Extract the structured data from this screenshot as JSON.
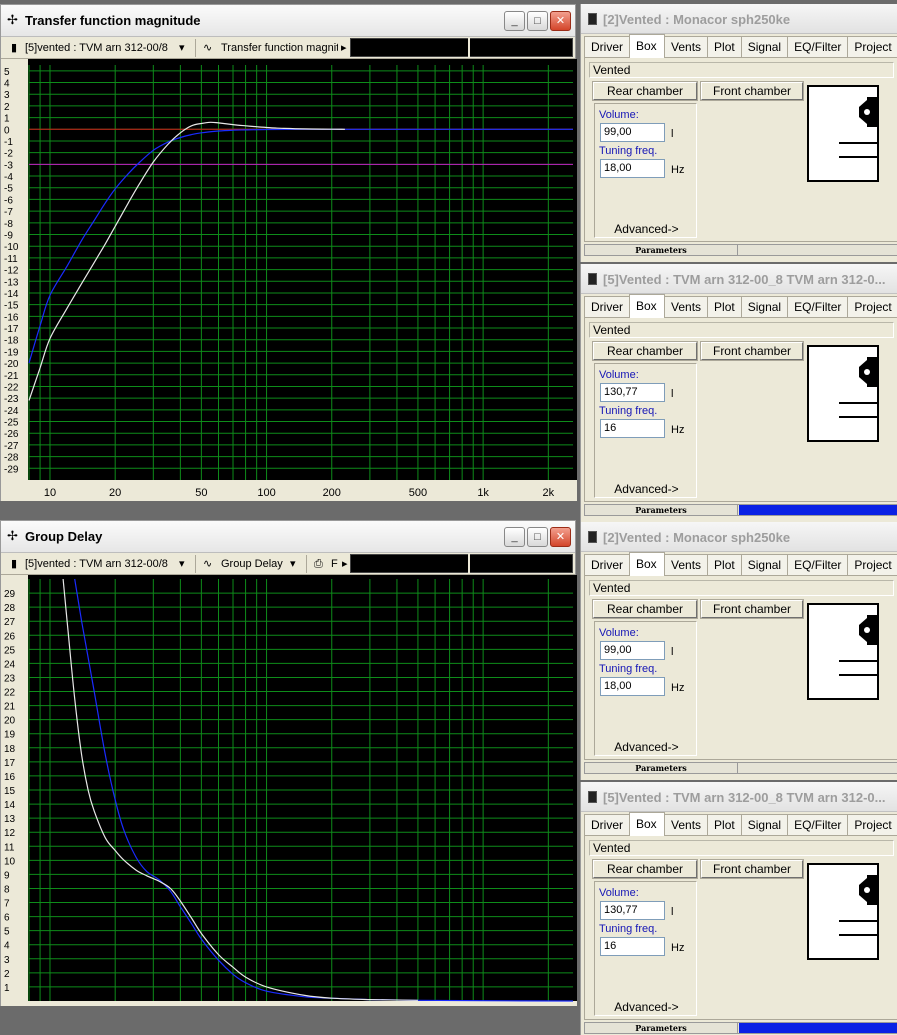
{
  "windows": {
    "magnitude": {
      "title": "Transfer function magnitude",
      "driver_select": "[5]vented : TVM arn 312-00/8",
      "view_select": "Transfer function magnitu",
      "y_ticks": [
        "5",
        "4",
        "3",
        "2",
        "1",
        "0",
        "-1",
        "-2",
        "-3",
        "-4",
        "-5",
        "-6",
        "-7",
        "-8",
        "-9",
        "-10",
        "-11",
        "-12",
        "-13",
        "-14",
        "-15",
        "-16",
        "-17",
        "-18",
        "-19",
        "-20",
        "-21",
        "-22",
        "-23",
        "-24",
        "-25",
        "-26",
        "-27",
        "-28",
        "-29"
      ],
      "x_ticks": [
        "10",
        "20",
        "50",
        "100",
        "200",
        "500",
        "1k",
        "2k"
      ]
    },
    "delay": {
      "title": "Group Delay",
      "driver_select": "[5]vented : TVM arn 312-00/8",
      "view_select": "Group Delay",
      "print_label": "F",
      "y_ticks": [
        "29",
        "28",
        "27",
        "26",
        "25",
        "24",
        "23",
        "22",
        "21",
        "20",
        "19",
        "18",
        "17",
        "16",
        "15",
        "14",
        "13",
        "12",
        "11",
        "10",
        "9",
        "8",
        "7",
        "6",
        "5",
        "4",
        "3",
        "2",
        "1"
      ],
      "x_ticks": [
        "10",
        "20",
        "50",
        "100",
        "200",
        "500",
        "1k",
        "2k"
      ]
    }
  },
  "chart_data": [
    {
      "type": "line",
      "title": "Transfer function magnitude",
      "x_scale": "log",
      "xlim": [
        8,
        2600
      ],
      "ylim": [
        -30,
        5.5
      ],
      "grid": true,
      "reference_lines": [
        {
          "y": 0,
          "color": "#d11a1a"
        },
        {
          "y": -3,
          "color": "#c21bc2"
        }
      ],
      "series": [
        {
          "color": "#1a2bff",
          "x": [
            8,
            9,
            10,
            12,
            14,
            16,
            18,
            20,
            23,
            26,
            30,
            35,
            40,
            45,
            50,
            60,
            70,
            80,
            100,
            150,
            200,
            300,
            500,
            1000,
            2600
          ],
          "y": [
            -20,
            -16.8,
            -14.2,
            -11.7,
            -9.5,
            -7.8,
            -6.3,
            -5.1,
            -3.8,
            -2.8,
            -1.8,
            -1.1,
            -0.7,
            -0.45,
            -0.3,
            -0.15,
            -0.08,
            -0.05,
            -0.02,
            0,
            0,
            0,
            0,
            0,
            0
          ]
        },
        {
          "color": "#e8e8e8",
          "x": [
            8,
            9,
            10,
            12,
            14,
            16,
            18,
            20,
            23,
            26,
            30,
            35,
            40,
            45,
            50,
            55,
            60,
            70,
            80,
            100,
            120,
            150,
            200,
            230
          ],
          "y": [
            -23.2,
            -20.4,
            -17.9,
            -15.3,
            -13.2,
            -11.4,
            -9.8,
            -8.3,
            -6.3,
            -4.6,
            -2.8,
            -1.3,
            -0.3,
            0.3,
            0.5,
            0.6,
            0.55,
            0.4,
            0.3,
            0.15,
            0.08,
            0.03,
            0.01,
            0
          ]
        }
      ]
    },
    {
      "type": "line",
      "title": "Group Delay",
      "x_scale": "log",
      "xlim": [
        8,
        2600
      ],
      "ylim": [
        0,
        30
      ],
      "grid": true,
      "series": [
        {
          "color": "#1a2bff",
          "x": [
            13,
            14,
            16,
            18,
            20,
            22,
            25,
            28,
            32,
            36,
            40,
            45,
            50,
            60,
            70,
            80,
            100,
            150,
            200,
            300,
            500,
            1000,
            2600
          ],
          "y": [
            30,
            27,
            22,
            17.5,
            14.3,
            12.1,
            10.2,
            9.2,
            8.6,
            7.8,
            6.7,
            5.5,
            4.4,
            2.9,
            1.9,
            1.3,
            0.7,
            0.3,
            0.2,
            0.1,
            0.05,
            0.02,
            0
          ]
        },
        {
          "color": "#e8e8e8",
          "x": [
            11.5,
            12,
            13,
            14,
            15,
            16,
            18,
            20,
            22,
            25,
            28,
            32,
            36,
            40,
            45,
            50,
            60,
            70,
            80,
            100,
            150,
            200,
            300,
            500
          ],
          "y": [
            30,
            27,
            21.5,
            17.5,
            15,
            13.5,
            11.6,
            10.7,
            10,
            9.3,
            8.9,
            8.5,
            8,
            7.1,
            5.9,
            4.8,
            3.3,
            2.4,
            1.7,
            1,
            0.4,
            0.2,
            0.1,
            0.05
          ]
        }
      ]
    }
  ],
  "panels": [
    {
      "title": "[2]Vented : Monacor sph250ke",
      "volume": "99,00",
      "tuning": "18,00",
      "params_active": false
    },
    {
      "title": "[5]Vented : TVM arn 312-00_8 TVM arn 312-0...",
      "volume": "130,77",
      "tuning": "16",
      "params_active": true
    },
    {
      "title": "[2]Vented : Monacor sph250ke",
      "volume": "99,00",
      "tuning": "18,00",
      "params_active": false
    },
    {
      "title": "[5]Vented : TVM arn 312-00_8 TVM arn 312-0...",
      "volume": "130,77",
      "tuning": "16",
      "params_active": true
    }
  ],
  "panel_common": {
    "tabs": [
      "Driver",
      "Box",
      "Vents",
      "Plot",
      "Signal",
      "EQ/Filter",
      "Project"
    ],
    "box_type": "Vented",
    "rear_button": "Rear chamber",
    "front_button": "Front chamber",
    "volume_label": "Volume:",
    "volume_unit": "l",
    "tuning_label": "Tuning freq.",
    "tuning_unit": "Hz",
    "advanced_label": "Advanced->",
    "parameters_label": "Parameters"
  },
  "colors": {
    "grid": "#0e8c1a",
    "plot_bg": "#000000",
    "tick_text": "#000000",
    "active_bar": "#0a21e4"
  }
}
